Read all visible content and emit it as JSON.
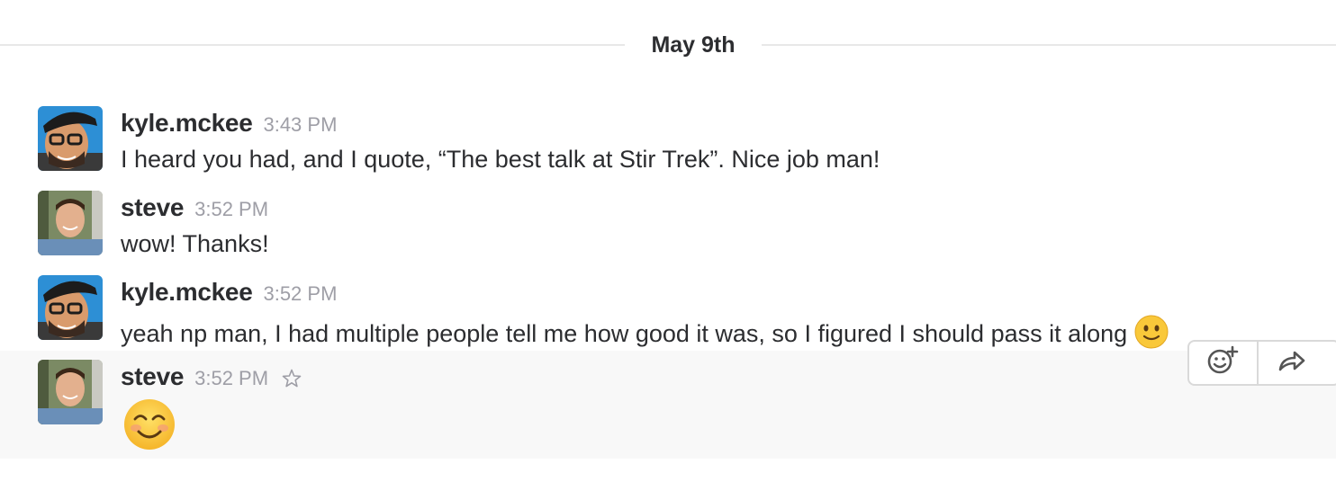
{
  "divider": {
    "label": "May 9th"
  },
  "messages": [
    {
      "author": "kyle.mckee",
      "time": "3:43 PM",
      "text": "I heard you had, and I quote, “The best talk at Stir Trek”.  Nice job man!",
      "avatar": "kyle-avatar"
    },
    {
      "author": "steve",
      "time": "3:52 PM",
      "text": "wow!  Thanks!",
      "avatar": "steve-avatar"
    },
    {
      "author": "kyle.mckee",
      "time": "3:52 PM",
      "text": "yeah np man, I had multiple people tell me how good it was, so I figured I should pass it along",
      "trailing_emoji": "slightly-smiling-face"
    },
    {
      "author": "steve",
      "time": "3:52 PM",
      "emoji": "smiling-face-with-smiling-eyes",
      "hovered": true
    }
  ],
  "actions": {
    "items": [
      "add-reaction-icon",
      "share-icon"
    ]
  },
  "colors": {
    "hover_bg": "#f8f8f8",
    "timestamp": "#9e9ea6",
    "text": "#2c2d30"
  }
}
